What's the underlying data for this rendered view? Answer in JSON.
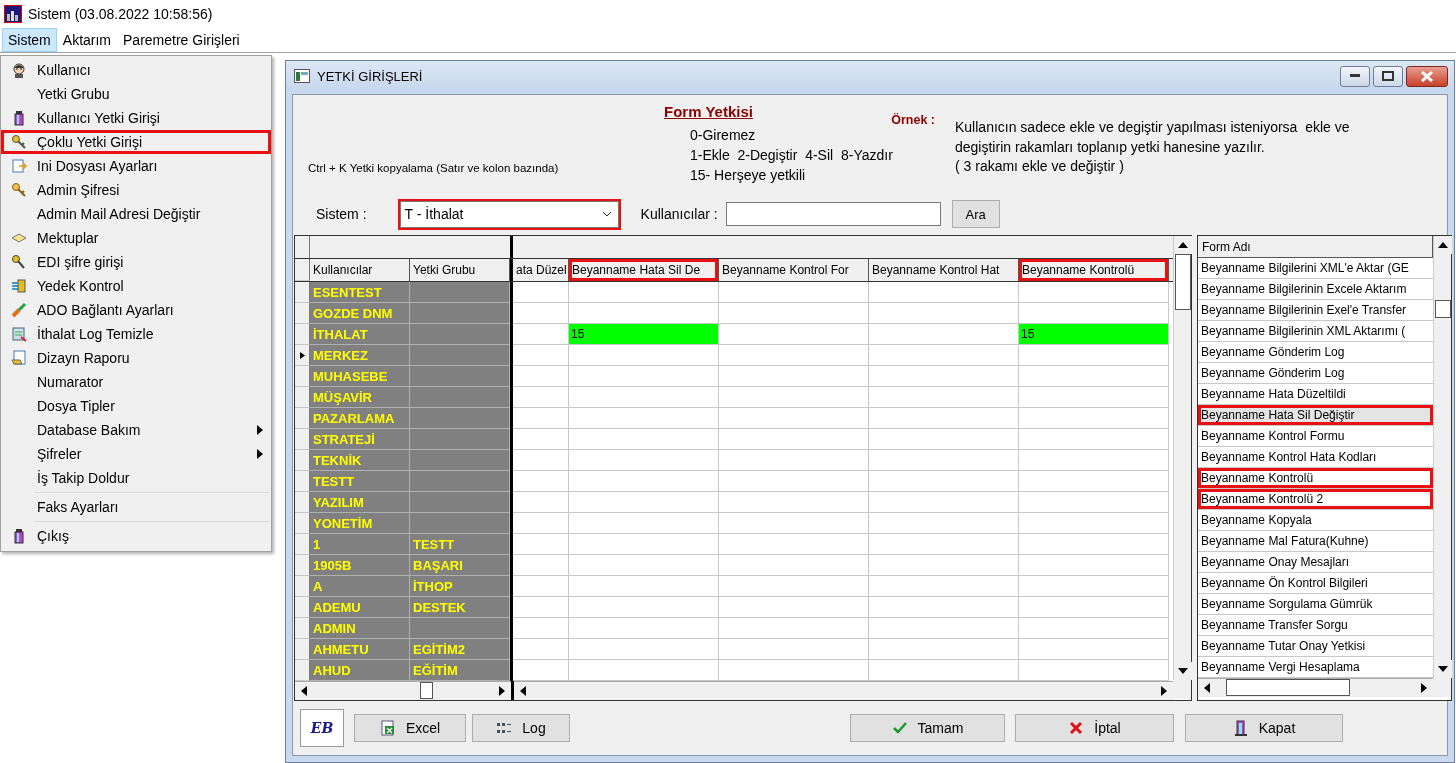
{
  "app": {
    "title": "Sistem (03.08.2022 10:58:56)"
  },
  "menubar": [
    {
      "label": "Sistem",
      "selected": true
    },
    {
      "label": "Aktarım",
      "selected": false
    },
    {
      "label": "Paremetre Girişleri",
      "selected": false
    }
  ],
  "open_menu": {
    "items": [
      {
        "kind": "item",
        "label": "Kullanıcı",
        "has_icon": true,
        "has_submenu": false,
        "highlighted": false
      },
      {
        "kind": "item",
        "label": "Yetki Grubu",
        "has_icon": false,
        "has_submenu": false,
        "highlighted": false
      },
      {
        "kind": "item",
        "label": "Kullanıcı Yetki Girişi",
        "has_icon": true,
        "has_submenu": false,
        "highlighted": false
      },
      {
        "kind": "item",
        "label": "Çoklu Yetki Girişi",
        "has_icon": true,
        "has_submenu": false,
        "highlighted": true
      },
      {
        "kind": "item",
        "label": "Ini Dosyası  Ayarları",
        "has_icon": true,
        "has_submenu": false,
        "highlighted": false
      },
      {
        "kind": "item",
        "label": "Admin Şifresi",
        "has_icon": true,
        "has_submenu": false,
        "highlighted": false
      },
      {
        "kind": "item",
        "label": "Admin Mail Adresi Değiştir",
        "has_icon": false,
        "has_submenu": false,
        "highlighted": false
      },
      {
        "kind": "item",
        "label": "Mektuplar",
        "has_icon": true,
        "has_submenu": false,
        "highlighted": false
      },
      {
        "kind": "item",
        "label": "EDI şifre girişi",
        "has_icon": true,
        "has_submenu": false,
        "highlighted": false
      },
      {
        "kind": "item",
        "label": "Yedek Kontrol",
        "has_icon": true,
        "has_submenu": false,
        "highlighted": false
      },
      {
        "kind": "item",
        "label": "ADO Bağlantı Ayarları",
        "has_icon": true,
        "has_submenu": false,
        "highlighted": false
      },
      {
        "kind": "item",
        "label": "İthalat Log Temizle",
        "has_icon": true,
        "has_submenu": false,
        "highlighted": false
      },
      {
        "kind": "item",
        "label": "Dizayn Raporu",
        "has_icon": true,
        "has_submenu": false,
        "highlighted": false
      },
      {
        "kind": "item",
        "label": "Numarator",
        "has_icon": false,
        "has_submenu": false,
        "highlighted": false
      },
      {
        "kind": "item",
        "label": "Dosya Tipler",
        "has_icon": false,
        "has_submenu": false,
        "highlighted": false
      },
      {
        "kind": "item",
        "label": "Database Bakım",
        "has_icon": false,
        "has_submenu": true,
        "highlighted": false
      },
      {
        "kind": "item",
        "label": "Şifreler",
        "has_icon": false,
        "has_submenu": true,
        "highlighted": false
      },
      {
        "kind": "item",
        "label": "İş Takip Doldur",
        "has_icon": false,
        "has_submenu": false,
        "highlighted": false
      },
      {
        "kind": "separator"
      },
      {
        "kind": "item",
        "label": "Faks Ayarları",
        "has_icon": false,
        "has_submenu": false,
        "highlighted": false
      },
      {
        "kind": "separator"
      },
      {
        "kind": "item",
        "label": "Çıkış",
        "has_icon": true,
        "has_submenu": false,
        "highlighted": false
      }
    ]
  },
  "dialog": {
    "title": "YETKİ GİRİŞLERİ",
    "form_heading": "Form Yetkisi",
    "shortcut_hint": "Ctrl + K Yetki kopyalama (Satır ve kolon bazında)",
    "codes": [
      "0-Giremez",
      "1-Ekle  2-Degiştir  4-Sil  8-Yazdır",
      "15- Herşeye yetkili"
    ],
    "example_label": "Örnek :",
    "example_lines": [
      "Kullanıcın sadece ekle ve degiştir yapılması isteniyorsa  ekle ve",
      "degiştirin rakamları toplanıp yetki hanesine yazılır.",
      "( 3 rakamı ekle ve değiştir )"
    ],
    "sistem_label": "Sistem :",
    "sistem_select": {
      "value": "T - İthalat",
      "highlighted": true
    },
    "users_label": "Kullanıcılar :",
    "search_button": "Ara",
    "grid": {
      "fixed_columns": [
        "Kullanıcılar",
        "Yetki Grubu"
      ],
      "columns": [
        {
          "label": "ata Düzel",
          "highlighted": false
        },
        {
          "label": "Beyanname Hata Sil De",
          "highlighted": true
        },
        {
          "label": "Beyanname Kontrol For",
          "highlighted": false
        },
        {
          "label": "Beyanname Kontrol Hat",
          "highlighted": false
        },
        {
          "label": "Beyanname Kontrolü",
          "highlighted": true
        }
      ],
      "rows": [
        {
          "user": "ESENTEST",
          "current": false
        },
        {
          "user": "GOZDE DNM",
          "current": false
        },
        {
          "user": "İTHALAT",
          "current": false,
          "cells": [
            null,
            "15",
            null,
            null,
            "15"
          ]
        },
        {
          "user": "MERKEZ",
          "current": true
        },
        {
          "user": "MUHASEBE",
          "current": false
        },
        {
          "user": "MÜŞAVİR",
          "current": false
        },
        {
          "user": "PAZARLAMA",
          "current": false
        },
        {
          "user": "STRATEJİ",
          "current": false
        },
        {
          "user": "TEKNİK",
          "current": false
        },
        {
          "user": "TESTT",
          "current": false
        },
        {
          "user": "YAZILIM",
          "current": false
        },
        {
          "user": "YONETİM",
          "current": false
        },
        {
          "user": "1",
          "group": "TESTT",
          "current": false
        },
        {
          "user": "1905B",
          "group": "BAŞARI",
          "current": false
        },
        {
          "user": "A",
          "group": "İTHOP",
          "current": false
        },
        {
          "user": "ADEMU",
          "group": "DESTEK",
          "current": false
        },
        {
          "user": "ADMIN",
          "current": false
        },
        {
          "user": "AHMETU",
          "group": "EGİTİM2",
          "current": false
        },
        {
          "user": "AHUD",
          "group": "EĞİTİM",
          "current": false
        }
      ]
    },
    "form_list": {
      "header": "Form Adı",
      "items": [
        {
          "label": "Beyanname Bilgilerini XML'e Aktar (GE",
          "selected": false,
          "highlighted": false
        },
        {
          "label": "Beyanname Bilgilerinin Excele Aktarım",
          "selected": false,
          "highlighted": false
        },
        {
          "label": "Beyanname Bilgilerinin Exel'e Transfer",
          "selected": false,
          "highlighted": false
        },
        {
          "label": "Beyanname Bilgilerinin XML Aktarımı (",
          "selected": false,
          "highlighted": false
        },
        {
          "label": "Beyanname Gönderim Log",
          "selected": false,
          "highlighted": false
        },
        {
          "label": "Beyanname Gönderim Log",
          "selected": false,
          "highlighted": false
        },
        {
          "label": "Beyanname Hata Düzeltildi",
          "selected": false,
          "highlighted": false
        },
        {
          "label": "Beyanname Hata Sil Değiştir",
          "selected": true,
          "highlighted": true
        },
        {
          "label": "Beyanname Kontrol Formu",
          "selected": false,
          "highlighted": false
        },
        {
          "label": "Beyanname Kontrol Hata Kodları",
          "selected": false,
          "highlighted": false
        },
        {
          "label": "Beyanname Kontrolü",
          "selected": false,
          "highlighted": true
        },
        {
          "label": "Beyanname Kontrolü 2",
          "selected": false,
          "highlighted": true
        },
        {
          "label": "Beyanname Kopyala",
          "selected": false,
          "highlighted": false
        },
        {
          "label": "Beyanname Mal Fatura(Kuhne)",
          "selected": false,
          "highlighted": false
        },
        {
          "label": "Beyanname Onay Mesajları",
          "selected": false,
          "highlighted": false
        },
        {
          "label": "Beyanname Ön Kontrol Bilgileri",
          "selected": false,
          "highlighted": false
        },
        {
          "label": "Beyanname Sorgulama Gümrük",
          "selected": false,
          "highlighted": false
        },
        {
          "label": "Beyanname Transfer Sorgu",
          "selected": false,
          "highlighted": false
        },
        {
          "label": "Beyanname Tutar Onay Yetkisi",
          "selected": false,
          "highlighted": false
        },
        {
          "label": "Beyanname Vergi Hesaplama",
          "selected": false,
          "highlighted": false
        }
      ]
    },
    "logo": "EB",
    "buttons": [
      {
        "kind": "excel",
        "label": "Excel"
      },
      {
        "kind": "log",
        "label": "Log"
      },
      {
        "kind": "ok",
        "label": "Tamam"
      },
      {
        "kind": "cancel",
        "label": "İptal"
      },
      {
        "kind": "close",
        "label": "Kapat"
      }
    ]
  }
}
